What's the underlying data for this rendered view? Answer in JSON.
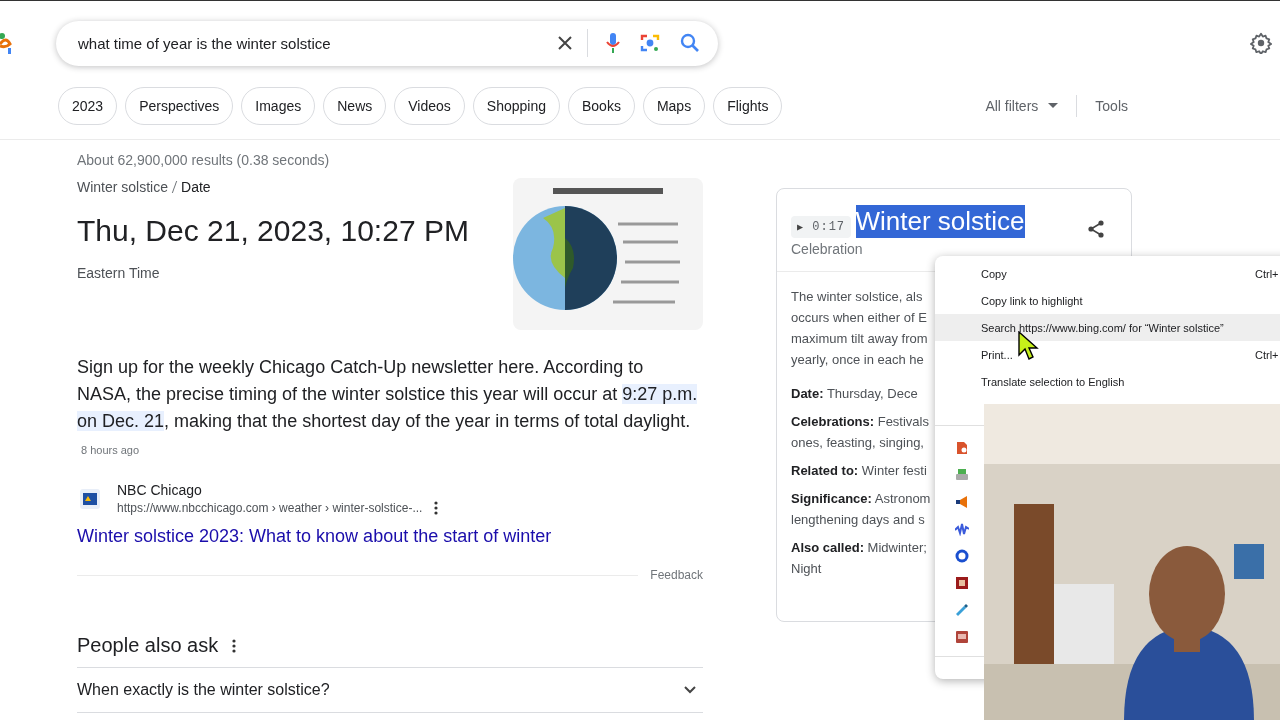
{
  "search": {
    "value": "what time of year is the winter solstice"
  },
  "chips": [
    "2023",
    "Perspectives",
    "Images",
    "News",
    "Videos",
    "Shopping",
    "Books",
    "Maps",
    "Flights"
  ],
  "filters": {
    "all_filters": "All filters",
    "tools": "Tools"
  },
  "result_stats": "About 62,900,000 results (0.38 seconds)",
  "featured": {
    "breadcrumb": [
      "Winter solstice",
      "Date"
    ],
    "answer": "Thu, Dec 21, 2023, 10:27 PM",
    "timezone": "Eastern Time"
  },
  "snippet": {
    "before": "Sign up for the weekly Chicago Catch-Up newsletter here. According to NASA, the precise timing of the winter solstice this year will occur at ",
    "highlighted": "9:27 p.m. on Dec. 21",
    "after": ", making that the shortest day of the year in terms of total daylight.",
    "age": "8 hours ago"
  },
  "source": {
    "name": "NBC Chicago",
    "url": "https://www.nbcchicago.com › weather › winter-solstice-...",
    "title": "Winter solstice 2023: What to know about the start of winter"
  },
  "feedback": "Feedback",
  "people_also_ask": {
    "heading": "People also ask",
    "questions": [
      {
        "text": "When exactly is the winter solstice?",
        "expanded": false
      }
    ]
  },
  "knowledge_panel": {
    "video": {
      "icon": "▶",
      "duration": "0:17"
    },
    "title": {
      "text": "Winter solstice",
      "selected": true
    },
    "subtitle": "Celebration",
    "description_lines": [
      "The winter solstice, als",
      "occurs when either of E",
      "maximum tilt away from",
      "yearly, once in each he"
    ],
    "facts": [
      {
        "label": "Date:",
        "lines": [
          "Thursday, Dece"
        ]
      },
      {
        "label": "Celebrations:",
        "lines": [
          "Festivals",
          "ones, feasting, singing,"
        ]
      },
      {
        "label": "Related to:",
        "lines": [
          "Winter festi"
        ]
      },
      {
        "label": "Significance:",
        "lines": [
          "Astronom",
          "lengthening days and s"
        ]
      },
      {
        "label": "Also called:",
        "lines": [
          "Midwinter;",
          "Night"
        ]
      }
    ]
  },
  "context_menu": {
    "items": [
      {
        "label": "Copy",
        "shortcut": "Ctrl+",
        "highlighted": false
      },
      {
        "label": "Copy link to highlight",
        "highlighted": false
      },
      {
        "label": "Search https://www.bing.com/ for “Winter solstice”",
        "highlighted": true
      },
      {
        "label": "Print...",
        "shortcut": "Ctrl+",
        "highlighted": false
      },
      {
        "label": "Translate selection to English",
        "highlighted": false
      }
    ],
    "extensions": [
      {
        "kind": "document"
      },
      {
        "kind": "printer"
      },
      {
        "kind": "megaphone"
      },
      {
        "kind": "wave"
      },
      {
        "kind": "disc"
      },
      {
        "kind": "book"
      },
      {
        "kind": "marker"
      },
      {
        "kind": "dictionary"
      }
    ]
  }
}
